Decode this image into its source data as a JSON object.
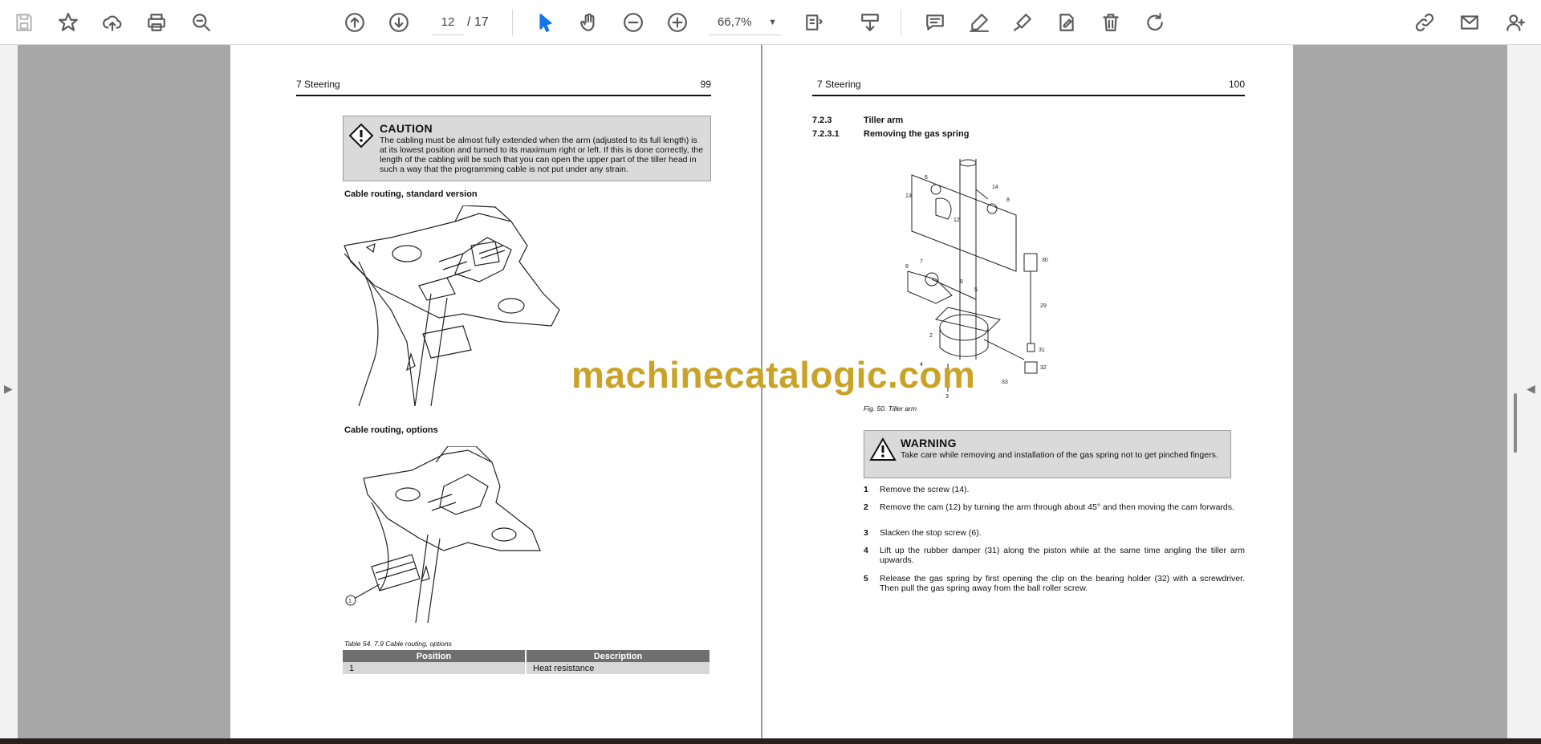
{
  "toolbar": {
    "page_current": "12",
    "page_total": "/  17",
    "zoom": "66,7%"
  },
  "left_page": {
    "section": "7 Steering",
    "page_number": "99",
    "caution": {
      "title": "CAUTION",
      "text": "The cabling must be almost fully extended when the arm (adjusted to its full length) is at its lowest position and turned to its maximum right or left. If this is done correctly, the length of the cabling will be such that you can open the upper part of the tiller head in such a way that the programming cable is not put under any strain."
    },
    "fig1_heading": "Cable routing, standard version",
    "fig2_heading": "Cable routing, options",
    "fig2_callout": "1",
    "table_caption": "Table 54. 7.9 Cable routing, options",
    "table": {
      "headers": [
        "Position",
        "Description"
      ],
      "rows": [
        [
          "1",
          "Heat resistance"
        ]
      ]
    }
  },
  "right_page": {
    "section": "7 Steering",
    "page_number": "100",
    "sub1_num": "7.2.3",
    "sub1_title": "Tiller arm",
    "sub2_num": "7.2.3.1",
    "sub2_title": "Removing the gas spring",
    "figure_callouts": [
      "6",
      "14",
      "8",
      "13",
      "12",
      "30",
      "8",
      "7",
      "9",
      "5",
      "29",
      "2",
      "31",
      "32",
      "4",
      "33",
      "3"
    ],
    "figure_caption": "Fig. 50. Tiller arm",
    "warning": {
      "title": "WARNING",
      "text": "Take care while removing and installation of the gas spring not to get pinched fingers."
    },
    "steps": [
      {
        "num": "1",
        "text": "Remove the screw (14)."
      },
      {
        "num": "2",
        "text": "Remove the cam (12) by turning the arm through about 45° and then moving the cam forwards."
      },
      {
        "num": "3",
        "text": "Slacken the stop screw (6)."
      },
      {
        "num": "4",
        "text": "Lift up the rubber damper (31) along the piston while at the same time angling the tiller arm upwards."
      },
      {
        "num": "5",
        "text": "Release the gas spring by first opening the clip on the bearing holder (32) with a screwdriver. Then pull the gas spring away from the ball roller screw."
      }
    ]
  },
  "watermark": "machinecatalogic.com",
  "icons": [
    "save-icon",
    "bookmark-star-icon",
    "cloud-upload-icon",
    "print-icon",
    "zoom-search-icon",
    "page-up-icon",
    "page-down-icon",
    "zoom-out-icon",
    "zoom-in-icon",
    "select-cursor-icon",
    "hand-tool-icon",
    "fit-page-icon",
    "scroll-mode-icon",
    "comment-icon",
    "highlight-pen-icon",
    "draw-icon",
    "fill-sign-icon",
    "delete-icon",
    "rotate-icon",
    "link-icon",
    "email-icon",
    "add-user-icon"
  ],
  "colors": {
    "accent": "#1473e6",
    "watermark": "#c9a227",
    "viewer_grey": "#a7a7a7"
  }
}
